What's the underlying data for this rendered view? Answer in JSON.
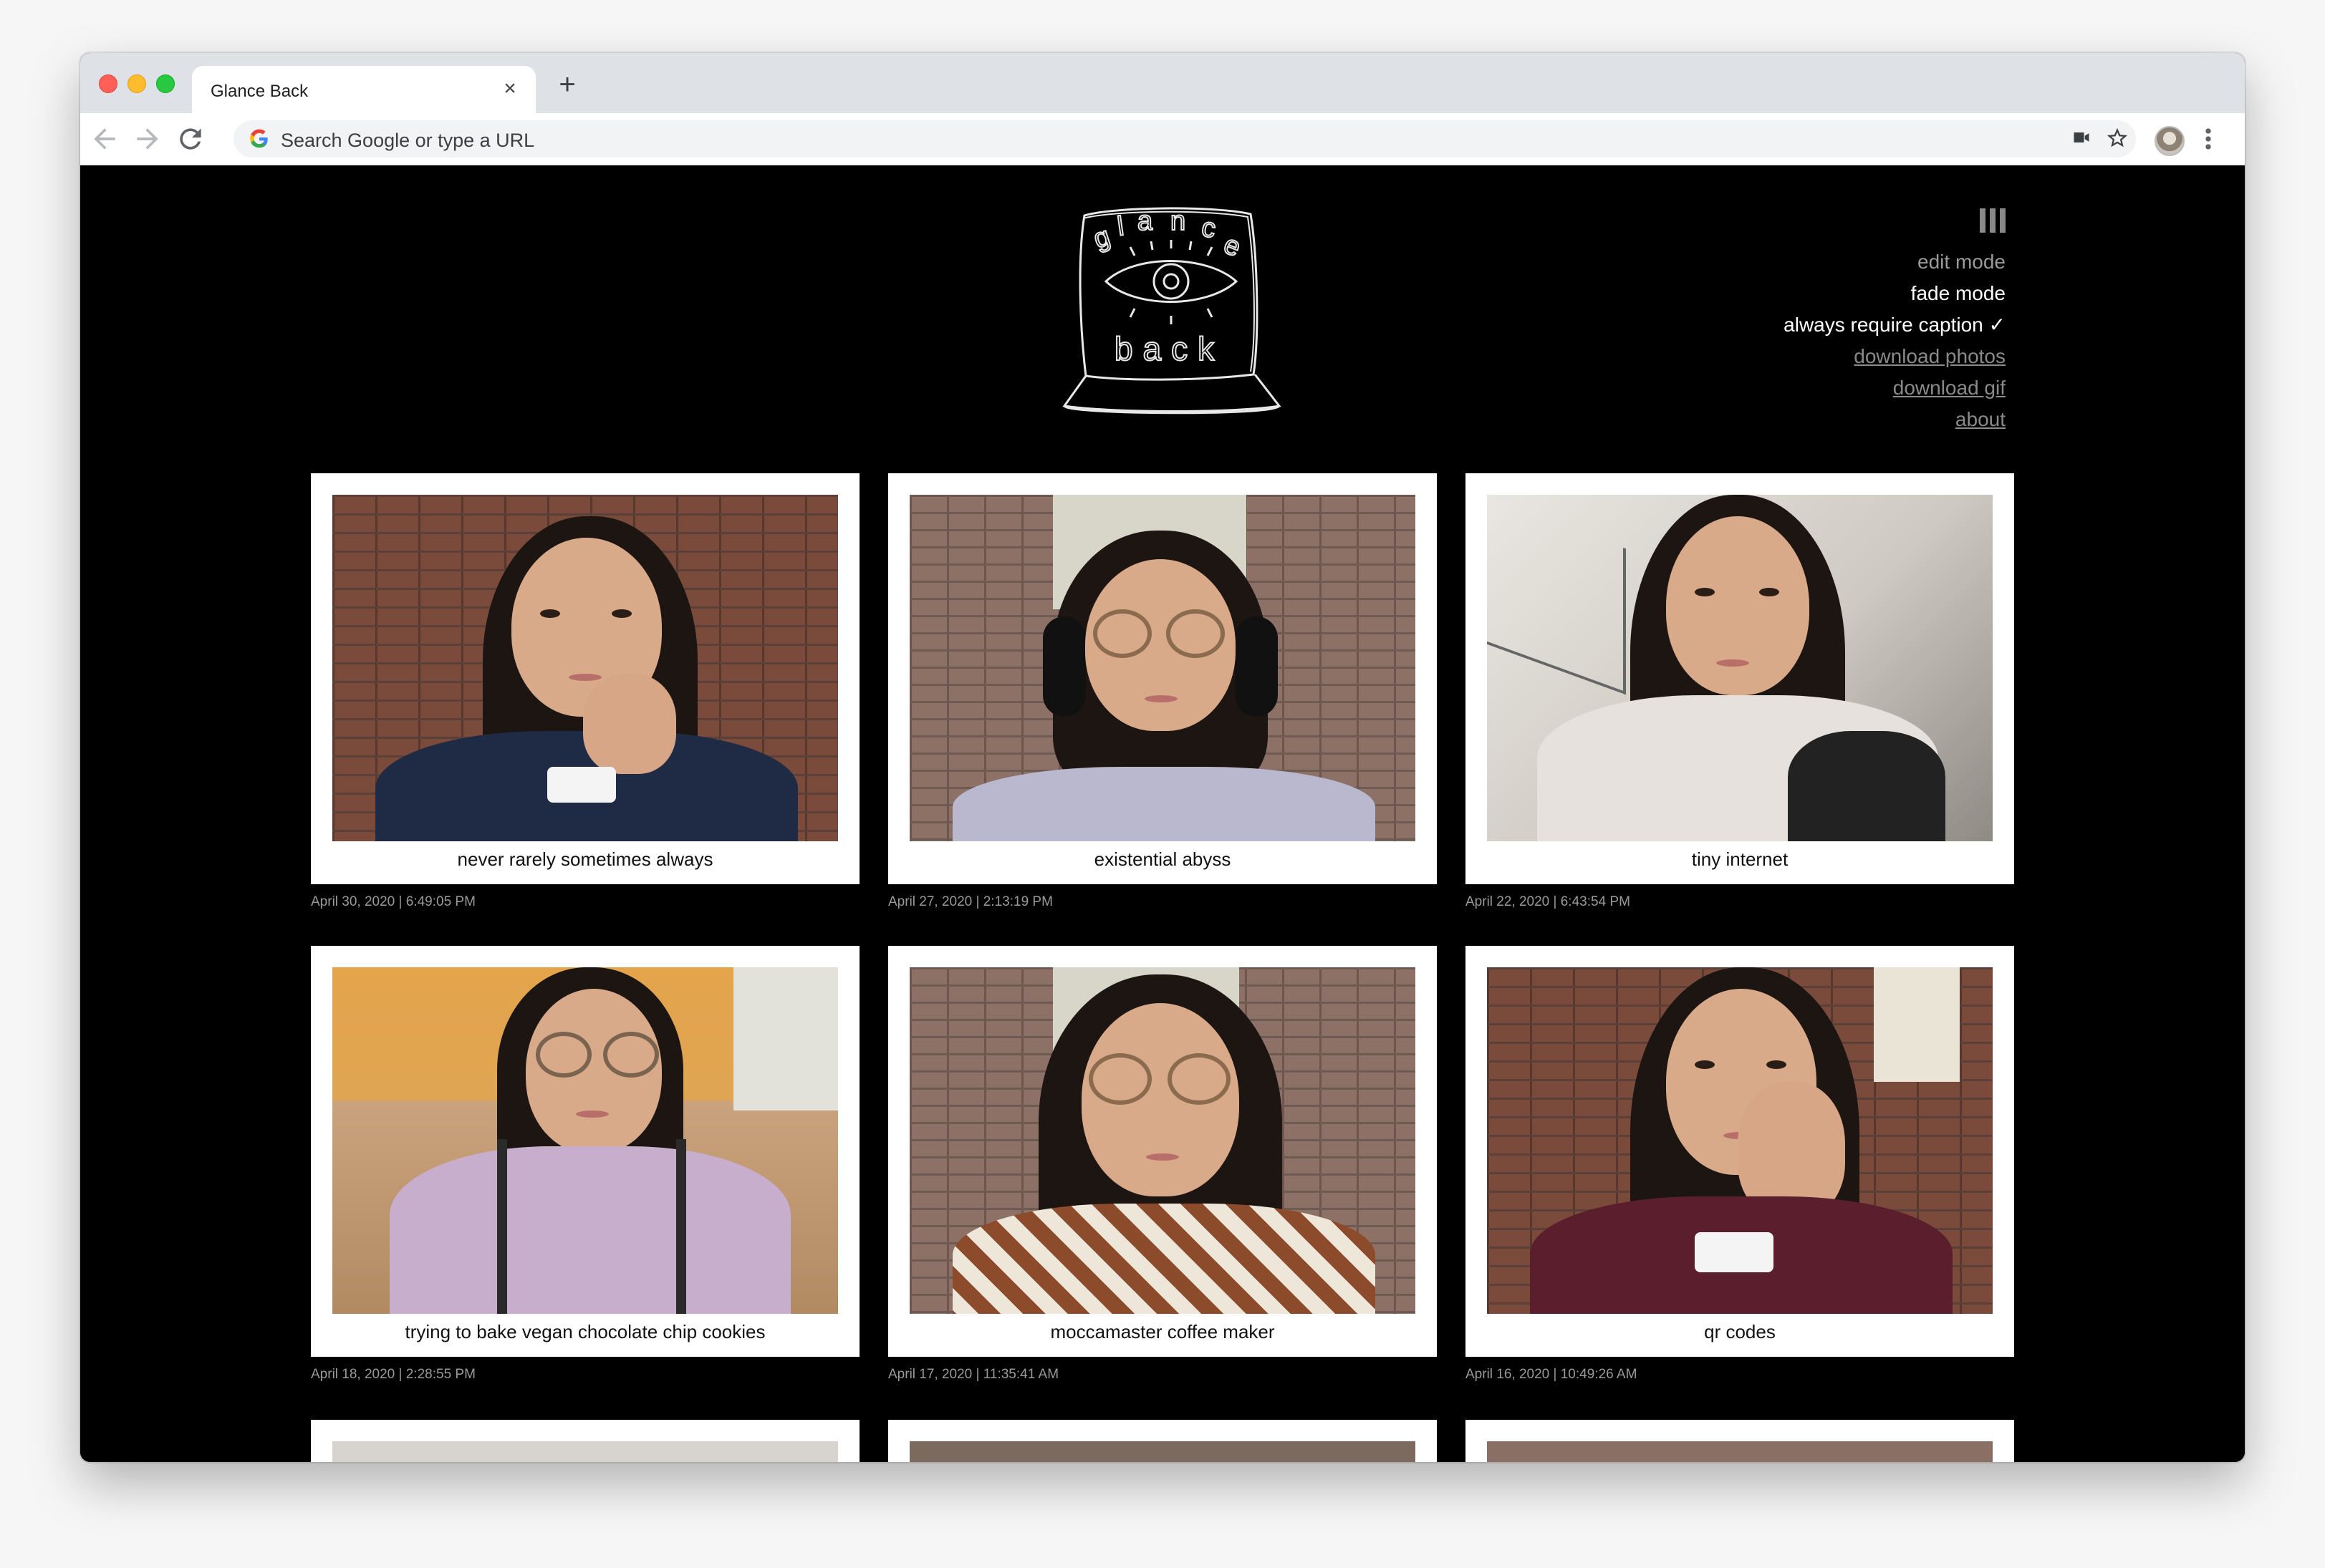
{
  "browser": {
    "tab_title": "Glance Back",
    "tab_close_glyph": "×",
    "new_tab_glyph": "+",
    "omnibox_placeholder": "Search Google or type a URL",
    "icons": [
      "back-arrow-icon",
      "forward-arrow-icon",
      "reload-icon",
      "google-icon",
      "camera-icon",
      "star-icon",
      "profile-avatar",
      "more-vert-icon"
    ]
  },
  "app": {
    "logo_alt": "glance back"
  },
  "menu": {
    "items": [
      {
        "label": "edit mode",
        "state": "inactive"
      },
      {
        "label": "fade mode",
        "state": "active"
      },
      {
        "label": "always require caption ✓",
        "state": "active"
      },
      {
        "label": "download photos",
        "state": "link"
      },
      {
        "label": "download gif",
        "state": "link"
      },
      {
        "label": "about",
        "state": "link"
      }
    ]
  },
  "photos": [
    {
      "caption": "never rarely sometimes always",
      "timestamp": "April 30, 2020 | 6:49:05 PM"
    },
    {
      "caption": "existential abyss",
      "timestamp": "April 27, 2020 | 2:13:19 PM"
    },
    {
      "caption": "tiny internet",
      "timestamp": "April 22, 2020 | 6:43:54 PM"
    },
    {
      "caption": "trying to bake vegan chocolate chip cookies",
      "timestamp": "April 18, 2020 | 2:28:55 PM"
    },
    {
      "caption": "moccamaster coffee maker",
      "timestamp": "April 17, 2020 | 11:35:41 AM"
    },
    {
      "caption": "qr codes",
      "timestamp": "April 16, 2020 | 10:49:26 AM"
    }
  ],
  "colors": {
    "page_bg": "#000000",
    "card_bg": "#ffffff",
    "menu_active": "#ffffff",
    "menu_inactive": "#9a9a9a"
  }
}
